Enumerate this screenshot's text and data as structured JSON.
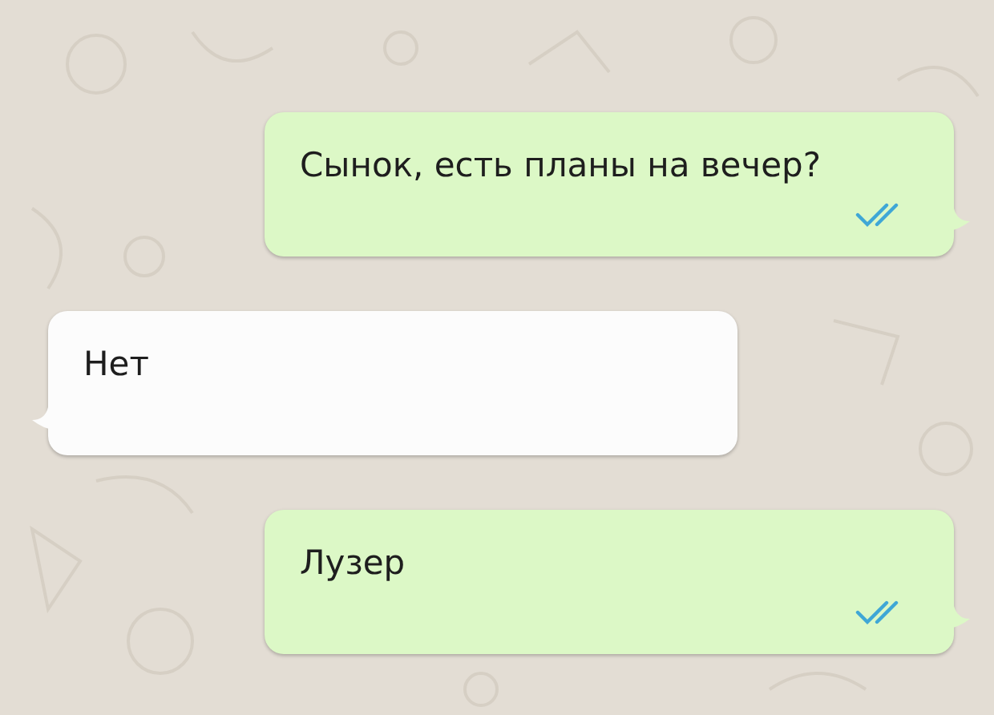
{
  "messages": [
    {
      "text": "Сынок, есть планы на вечер?",
      "kind": "outgoing",
      "read": true
    },
    {
      "text": "Нет",
      "kind": "incoming"
    },
    {
      "text": "Лузер",
      "kind": "outgoing",
      "read": true
    }
  ]
}
